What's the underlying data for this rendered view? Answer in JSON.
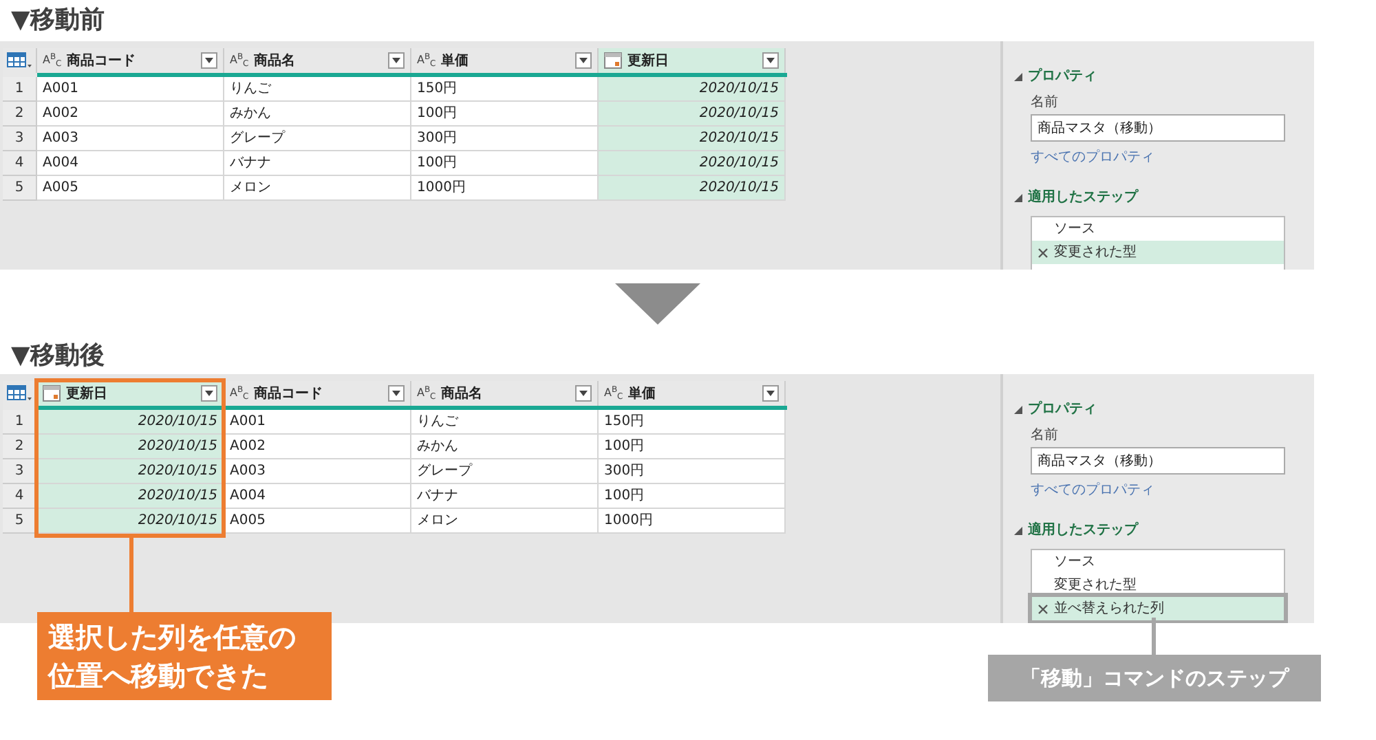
{
  "sections": [
    {
      "heading": "▼移動前",
      "table": {
        "columns": [
          {
            "kind": "text",
            "type_label": "A$^{B}$$_{C}$",
            "label": "商品コード",
            "selected": false,
            "outlined": false
          },
          {
            "kind": "text",
            "type_label": "A$^{B}$$_{C}$",
            "label": "商品名",
            "selected": false,
            "outlined": false
          },
          {
            "kind": "text",
            "type_label": "A$^{B}$$_{C}$",
            "label": "単価",
            "selected": false,
            "outlined": false
          },
          {
            "kind": "date",
            "label": "更新日",
            "selected": true,
            "outlined": false
          }
        ],
        "rows": [
          {
            "number": "1",
            "cells": [
              "A001",
              "りんご",
              "150円",
              "2020/10/15"
            ]
          },
          {
            "number": "2",
            "cells": [
              "A002",
              "みかん",
              "100円",
              "2020/10/15"
            ]
          },
          {
            "number": "3",
            "cells": [
              "A003",
              "グレープ",
              "300円",
              "2020/10/15"
            ]
          },
          {
            "number": "4",
            "cells": [
              "A004",
              "バナナ",
              "100円",
              "2020/10/15"
            ]
          },
          {
            "number": "5",
            "cells": [
              "A005",
              "メロン",
              "1000円",
              "2020/10/15"
            ]
          }
        ]
      },
      "properties": {
        "title": "プロパティ",
        "name_label": "名前",
        "name_value": "商品マスタ（移動）",
        "link": "すべてのプロパティ"
      },
      "steps": {
        "title": "適用したステップ",
        "items": [
          {
            "label": "ソース",
            "selected": false,
            "has_settings": false,
            "outlined": false
          },
          {
            "label": "変更された型",
            "selected": true,
            "has_settings": true,
            "outlined": false
          }
        ]
      }
    },
    {
      "heading": "▼移動後",
      "table": {
        "columns": [
          {
            "kind": "date",
            "label": "更新日",
            "selected": true,
            "outlined": true
          },
          {
            "kind": "text",
            "type_label": "A$^{B}$$_{C}$",
            "label": "商品コード",
            "selected": false,
            "outlined": false
          },
          {
            "kind": "text",
            "type_label": "A$^{B}$$_{C}$",
            "label": "商品名",
            "selected": false,
            "outlined": false
          },
          {
            "kind": "text",
            "type_label": "A$^{B}$$_{C}$",
            "label": "単価",
            "selected": false,
            "outlined": false
          }
        ],
        "rows": [
          {
            "number": "1",
            "cells": [
              "2020/10/15",
              "A001",
              "りんご",
              "150円"
            ]
          },
          {
            "number": "2",
            "cells": [
              "2020/10/15",
              "A002",
              "みかん",
              "100円"
            ]
          },
          {
            "number": "3",
            "cells": [
              "2020/10/15",
              "A003",
              "グレープ",
              "300円"
            ]
          },
          {
            "number": "4",
            "cells": [
              "2020/10/15",
              "A004",
              "バナナ",
              "100円"
            ]
          },
          {
            "number": "5",
            "cells": [
              "2020/10/15",
              "A005",
              "メロン",
              "1000円"
            ]
          }
        ]
      },
      "properties": {
        "title": "プロパティ",
        "name_label": "名前",
        "name_value": "商品マスタ（移動）",
        "link": "すべてのプロパティ"
      },
      "steps": {
        "title": "適用したステップ",
        "items": [
          {
            "label": "ソース",
            "selected": false,
            "has_settings": false,
            "outlined": false
          },
          {
            "label": "変更された型",
            "selected": false,
            "has_settings": false,
            "outlined": false
          },
          {
            "label": "並べ替えられた列",
            "selected": true,
            "has_settings": true,
            "outlined": true
          }
        ]
      }
    }
  ],
  "callouts": [
    {
      "kind": "orange",
      "text": "選択した列を任意の位置へ移動できた"
    },
    {
      "kind": "gray",
      "text": "「移動」コマンドのステップ"
    }
  ]
}
